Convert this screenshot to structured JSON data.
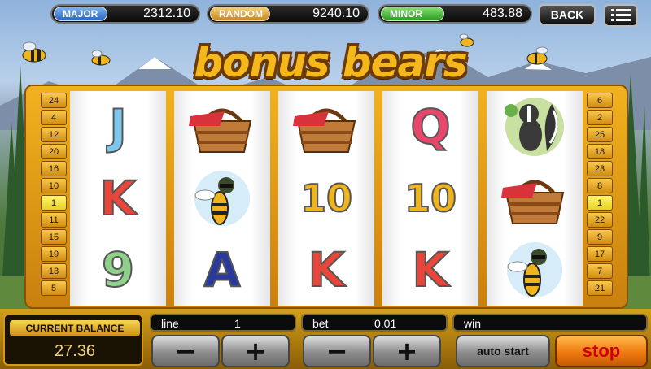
{
  "jackpots": {
    "major": {
      "label": "MAJOR",
      "value": "2312.10"
    },
    "random": {
      "label": "RANDOM",
      "value": "9240.10"
    },
    "minor": {
      "label": "MINOR",
      "value": "483.88"
    }
  },
  "header": {
    "back_label": "BACK",
    "menu_icon": "menu-icon"
  },
  "title": "bonus bears",
  "line_numbers": {
    "left": [
      "24",
      "4",
      "12",
      "20",
      "16",
      "10",
      "1",
      "11",
      "15",
      "19",
      "13",
      "5"
    ],
    "right": [
      "6",
      "2",
      "25",
      "18",
      "23",
      "8",
      "1",
      "22",
      "9",
      "17",
      "7",
      "21"
    ],
    "active": "1"
  },
  "reels": [
    [
      {
        "type": "letter",
        "text": "J",
        "color": "#7ec8ee"
      },
      {
        "type": "letter",
        "text": "K",
        "color": "#e8463a"
      },
      {
        "type": "letter",
        "text": "9",
        "color": "#8fd08a"
      }
    ],
    [
      {
        "type": "icon",
        "name": "picnic-basket-icon"
      },
      {
        "type": "icon",
        "name": "bee-icon"
      },
      {
        "type": "letter",
        "text": "A",
        "color": "#2a3a9c"
      }
    ],
    [
      {
        "type": "icon",
        "name": "picnic-basket-icon"
      },
      {
        "type": "letter",
        "text": "10",
        "color": "#f0b41c"
      },
      {
        "type": "letter",
        "text": "K",
        "color": "#e8463a"
      }
    ],
    [
      {
        "type": "letter",
        "text": "Q",
        "color": "#e8466a"
      },
      {
        "type": "letter",
        "text": "10",
        "color": "#f0b41c"
      },
      {
        "type": "letter",
        "text": "K",
        "color": "#e8463a"
      }
    ],
    [
      {
        "type": "icon",
        "name": "skunk-icon"
      },
      {
        "type": "icon",
        "name": "picnic-basket-icon"
      },
      {
        "type": "icon",
        "name": "bee-icon"
      }
    ]
  ],
  "balance": {
    "label": "CURRENT BALANCE",
    "value": "27.36"
  },
  "fields": {
    "line": {
      "label": "line",
      "value": "1"
    },
    "bet": {
      "label": "bet",
      "value": "0.01"
    },
    "win": {
      "label": "win",
      "value": ""
    }
  },
  "buttons": {
    "minus": "−",
    "plus": "+",
    "auto_start": "auto start",
    "stop": "stop"
  },
  "colors": {
    "frame": "#f2b21e",
    "stop": "#ee7a10"
  }
}
